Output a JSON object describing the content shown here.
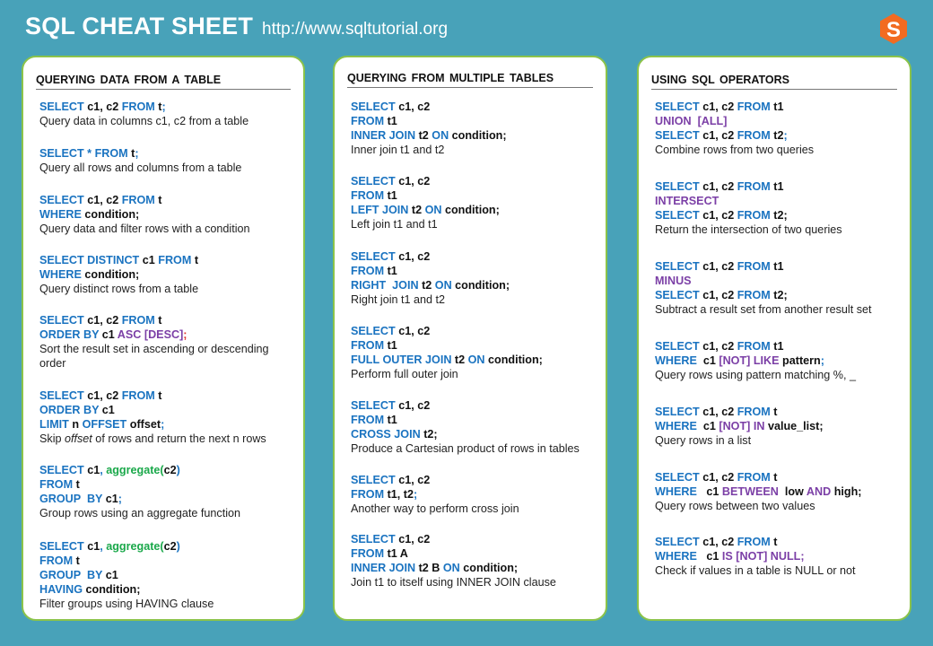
{
  "header": {
    "title": "SQL CHEAT SHEET",
    "url": "http://www.sqltutorial.org",
    "logo_letter": "S"
  },
  "colors": {
    "background": "#48a2b9",
    "keyword": "#1a73c0",
    "operator": "#7b3fa6",
    "function": "#1aa84a",
    "logo": "#f26b21",
    "panel_border": "#8bc34a"
  },
  "panels": [
    {
      "title": "QUERYING DATA FROM A TABLE",
      "entries": [
        {
          "lines": [
            [
              [
                "kw",
                "SELECT "
              ],
              [
                "t",
                "c1, c2 "
              ],
              [
                "kw",
                "FROM "
              ],
              [
                "t",
                "t"
              ],
              [
                "kw",
                ";"
              ]
            ]
          ],
          "desc": "Query data in columns c1, c2 from a table"
        },
        {
          "lines": [
            [
              [
                "kw",
                "SELECT * FROM "
              ],
              [
                "t",
                "t"
              ],
              [
                "kw",
                ";"
              ]
            ]
          ],
          "desc": "Query all rows and columns  from a table"
        },
        {
          "lines": [
            [
              [
                "kw",
                "SELECT "
              ],
              [
                "t",
                "c1, c2 "
              ],
              [
                "kw",
                "FROM "
              ],
              [
                "t",
                "t"
              ]
            ],
            [
              [
                "kw",
                "WHERE "
              ],
              [
                "t",
                "condition;"
              ]
            ]
          ],
          "desc": "Query data and filter rows with  a condition"
        },
        {
          "lines": [
            [
              [
                "kw",
                "SELECT DISTINCT "
              ],
              [
                "t",
                "c1 "
              ],
              [
                "kw",
                "FROM "
              ],
              [
                "t",
                "t"
              ]
            ],
            [
              [
                "kw",
                "WHERE "
              ],
              [
                "t",
                "condition;"
              ]
            ]
          ],
          "desc": "Query distinct  rows from a table"
        },
        {
          "lines": [
            [
              [
                "kw",
                "SELECT "
              ],
              [
                "t",
                "c1, c2 "
              ],
              [
                "kw",
                "FROM "
              ],
              [
                "t",
                "t"
              ]
            ],
            [
              [
                "kw",
                "ORDER BY "
              ],
              [
                "t",
                "c1 "
              ],
              [
                "op",
                "ASC [DESC]"
              ],
              [
                "red",
                ";"
              ]
            ]
          ],
          "desc": "Sort the  result set in  ascending or descending order"
        },
        {
          "lines": [
            [
              [
                "kw",
                "SELECT "
              ],
              [
                "t",
                "c1, c2 "
              ],
              [
                "kw",
                "FROM "
              ],
              [
                "t",
                "t"
              ]
            ],
            [
              [
                "kw",
                "ORDER BY "
              ],
              [
                "t",
                "c1"
              ]
            ],
            [
              [
                "kw",
                "LIMIT "
              ],
              [
                "t",
                "n "
              ],
              [
                "kw",
                "OFFSET "
              ],
              [
                "t",
                "offset"
              ],
              [
                "kw",
                ";"
              ]
            ]
          ],
          "desc_pre": "Skip ",
          "desc_em": "offset",
          "desc": " of rows and return the  next n  rows"
        },
        {
          "lines": [
            [
              [
                "kw",
                "SELECT "
              ],
              [
                "t",
                "c1"
              ],
              [
                "kw",
                ", "
              ],
              [
                "fn",
                "aggregate("
              ],
              [
                "t",
                "c2"
              ],
              [
                "kw",
                ")"
              ]
            ],
            [
              [
                "kw",
                "FROM "
              ],
              [
                "t",
                "t"
              ]
            ],
            [
              [
                "kw",
                "GROUP  BY "
              ],
              [
                "t",
                "c1"
              ],
              [
                "kw",
                ";"
              ]
            ]
          ],
          "desc": "Group rows using  an aggregate function"
        },
        {
          "lines": [
            [
              [
                "kw",
                "SELECT "
              ],
              [
                "t",
                "c1"
              ],
              [
                "kw",
                ", "
              ],
              [
                "fn",
                "aggregate("
              ],
              [
                "t",
                "c2"
              ],
              [
                "kw",
                ")"
              ]
            ],
            [
              [
                "kw",
                "FROM "
              ],
              [
                "t",
                "t"
              ]
            ],
            [
              [
                "kw",
                "GROUP  BY "
              ],
              [
                "t",
                "c1"
              ]
            ],
            [
              [
                "kw",
                "HAVING "
              ],
              [
                "t",
                "condition;"
              ]
            ]
          ],
          "desc": "Filter groups using  HAVING  clause"
        }
      ]
    },
    {
      "title": "QUERYING FROM MULTIPLE TABLES",
      "entries": [
        {
          "lines": [
            [
              [
                "kw",
                "SELECT "
              ],
              [
                "t",
                "c1, c2"
              ]
            ],
            [
              [
                "kw",
                "FROM "
              ],
              [
                "t",
                "t1"
              ]
            ],
            [
              [
                "kw",
                "INNER JOIN "
              ],
              [
                "t",
                "t2 "
              ],
              [
                "kw",
                "ON "
              ],
              [
                "t",
                "condition;"
              ]
            ]
          ],
          "desc": "Inner join t1 and t2"
        },
        {
          "lines": [
            [
              [
                "kw",
                "SELECT "
              ],
              [
                "t",
                "c1, c2"
              ]
            ],
            [
              [
                "kw",
                "FROM "
              ],
              [
                "t",
                "t1"
              ]
            ],
            [
              [
                "kw",
                "LEFT JOIN "
              ],
              [
                "t",
                "t2 "
              ],
              [
                "kw",
                "ON "
              ],
              [
                "t",
                "condition;"
              ]
            ]
          ],
          "desc": "Left join t1 and t1"
        },
        {
          "lines": [
            [
              [
                "kw",
                "SELECT "
              ],
              [
                "t",
                "c1, c2"
              ]
            ],
            [
              [
                "kw",
                "FROM "
              ],
              [
                "t",
                "t1"
              ]
            ],
            [
              [
                "kw",
                "RIGHT  JOIN "
              ],
              [
                "t",
                "t2 "
              ],
              [
                "kw",
                "ON "
              ],
              [
                "t",
                "condition;"
              ]
            ]
          ],
          "desc": "Right join t1  and t2"
        },
        {
          "lines": [
            [
              [
                "kw",
                "SELECT "
              ],
              [
                "t",
                "c1, c2"
              ]
            ],
            [
              [
                "kw",
                "FROM "
              ],
              [
                "t",
                "t1"
              ]
            ],
            [
              [
                "kw",
                "FULL OUTER JOIN "
              ],
              [
                "t",
                "t2 "
              ],
              [
                "kw",
                "ON "
              ],
              [
                "t",
                "condition;"
              ]
            ]
          ],
          "desc": "Perform full outer join"
        },
        {
          "lines": [
            [
              [
                "kw",
                "SELECT "
              ],
              [
                "t",
                "c1, c2"
              ]
            ],
            [
              [
                "kw",
                "FROM "
              ],
              [
                "t",
                "t1"
              ]
            ],
            [
              [
                "kw",
                "CROSS JOIN "
              ],
              [
                "t",
                "t2;"
              ]
            ]
          ],
          "desc": "Produce a Cartesian product of rows in tables"
        },
        {
          "lines": [
            [
              [
                "kw",
                "SELECT "
              ],
              [
                "t",
                "c1, c2"
              ]
            ],
            [
              [
                "kw",
                "FROM "
              ],
              [
                "t",
                "t1, t2"
              ],
              [
                "kw",
                ";"
              ]
            ]
          ],
          "desc": "Another  way to perform cross join"
        },
        {
          "lines": [
            [
              [
                "kw",
                "SELECT "
              ],
              [
                "t",
                "c1, c2"
              ]
            ],
            [
              [
                "kw",
                "FROM "
              ],
              [
                "t",
                "t1 A"
              ]
            ],
            [
              [
                "kw",
                "INNER JOIN "
              ],
              [
                "t",
                "t2 B "
              ],
              [
                "kw",
                "ON "
              ],
              [
                "t",
                "condition;"
              ]
            ]
          ],
          "desc": "Join t1 to itself using INNER JOIN clause"
        }
      ]
    },
    {
      "title": "USING  SQL OPERATORS",
      "entries": [
        {
          "lines": [
            [
              [
                "kw",
                "SELECT "
              ],
              [
                "t",
                "c1, c2 "
              ],
              [
                "kw",
                "FROM "
              ],
              [
                "t",
                "t1"
              ]
            ],
            [
              [
                "op",
                "UNION  [ALL]"
              ]
            ],
            [
              [
                "kw",
                "SELECT "
              ],
              [
                "t",
                "c1, c2 "
              ],
              [
                "kw",
                "FROM "
              ],
              [
                "t",
                "t2"
              ],
              [
                "kw",
                ";"
              ]
            ]
          ],
          "desc": "Combine rows from two queries"
        },
        {
          "lines": [
            [
              [
                "kw",
                "SELECT "
              ],
              [
                "t",
                "c1, c2 "
              ],
              [
                "kw",
                "FROM "
              ],
              [
                "t",
                "t1"
              ]
            ],
            [
              [
                "op",
                "INTERSECT"
              ]
            ],
            [
              [
                "kw",
                "SELECT "
              ],
              [
                "t",
                "c1, c2 "
              ],
              [
                "kw",
                "FROM "
              ],
              [
                "t",
                "t2;"
              ]
            ]
          ],
          "desc": "Return the  intersection of two queries"
        },
        {
          "lines": [
            [
              [
                "kw",
                "SELECT "
              ],
              [
                "t",
                "c1, c2 "
              ],
              [
                "kw",
                "FROM "
              ],
              [
                "t",
                "t1"
              ]
            ],
            [
              [
                "op",
                "MINUS"
              ]
            ],
            [
              [
                "kw",
                "SELECT "
              ],
              [
                "t",
                "c1, c2 "
              ],
              [
                "kw",
                "FROM "
              ],
              [
                "t",
                "t2;"
              ]
            ]
          ],
          "desc": "Subtract a result set from another result set"
        },
        {
          "lines": [
            [
              [
                "kw",
                "SELECT "
              ],
              [
                "t",
                "c1, c2 "
              ],
              [
                "kw",
                "FROM "
              ],
              [
                "t",
                "t1"
              ]
            ],
            [
              [
                "kw",
                "WHERE  "
              ],
              [
                "t",
                "c1 "
              ],
              [
                "op",
                "[NOT] LIKE "
              ],
              [
                "t",
                "pattern"
              ],
              [
                "kw",
                ";"
              ]
            ]
          ],
          "desc": "Query rows using  pattern matching  %, _"
        },
        {
          "lines": [
            [
              [
                "kw",
                "SELECT "
              ],
              [
                "t",
                "c1, c2 "
              ],
              [
                "kw",
                "FROM "
              ],
              [
                "t",
                "t"
              ]
            ],
            [
              [
                "kw",
                "WHERE  "
              ],
              [
                "t",
                "c1 "
              ],
              [
                "op",
                "[NOT] IN "
              ],
              [
                "t",
                "value_list;"
              ]
            ]
          ],
          "desc": "Query rows in a list"
        },
        {
          "lines": [
            [
              [
                "kw",
                "SELECT "
              ],
              [
                "t",
                "c1, c2 "
              ],
              [
                "kw",
                "FROM "
              ],
              [
                "t",
                "t"
              ]
            ],
            [
              [
                "kw",
                "WHERE   "
              ],
              [
                "t",
                "c1 "
              ],
              [
                "op",
                "BETWEEN "
              ],
              [
                "t",
                " low "
              ],
              [
                "op",
                "AND "
              ],
              [
                "t",
                "high;"
              ]
            ]
          ],
          "desc": "Query rows between two values"
        },
        {
          "lines": [
            [
              [
                "kw",
                "SELECT "
              ],
              [
                "t",
                "c1, c2 "
              ],
              [
                "kw",
                "FROM "
              ],
              [
                "t",
                "t"
              ]
            ],
            [
              [
                "kw",
                "WHERE   "
              ],
              [
                "t",
                "c1 "
              ],
              [
                "op",
                "IS [NOT] NULL;"
              ]
            ]
          ],
          "desc": "Check if values in a table is NULL or not"
        }
      ]
    }
  ]
}
